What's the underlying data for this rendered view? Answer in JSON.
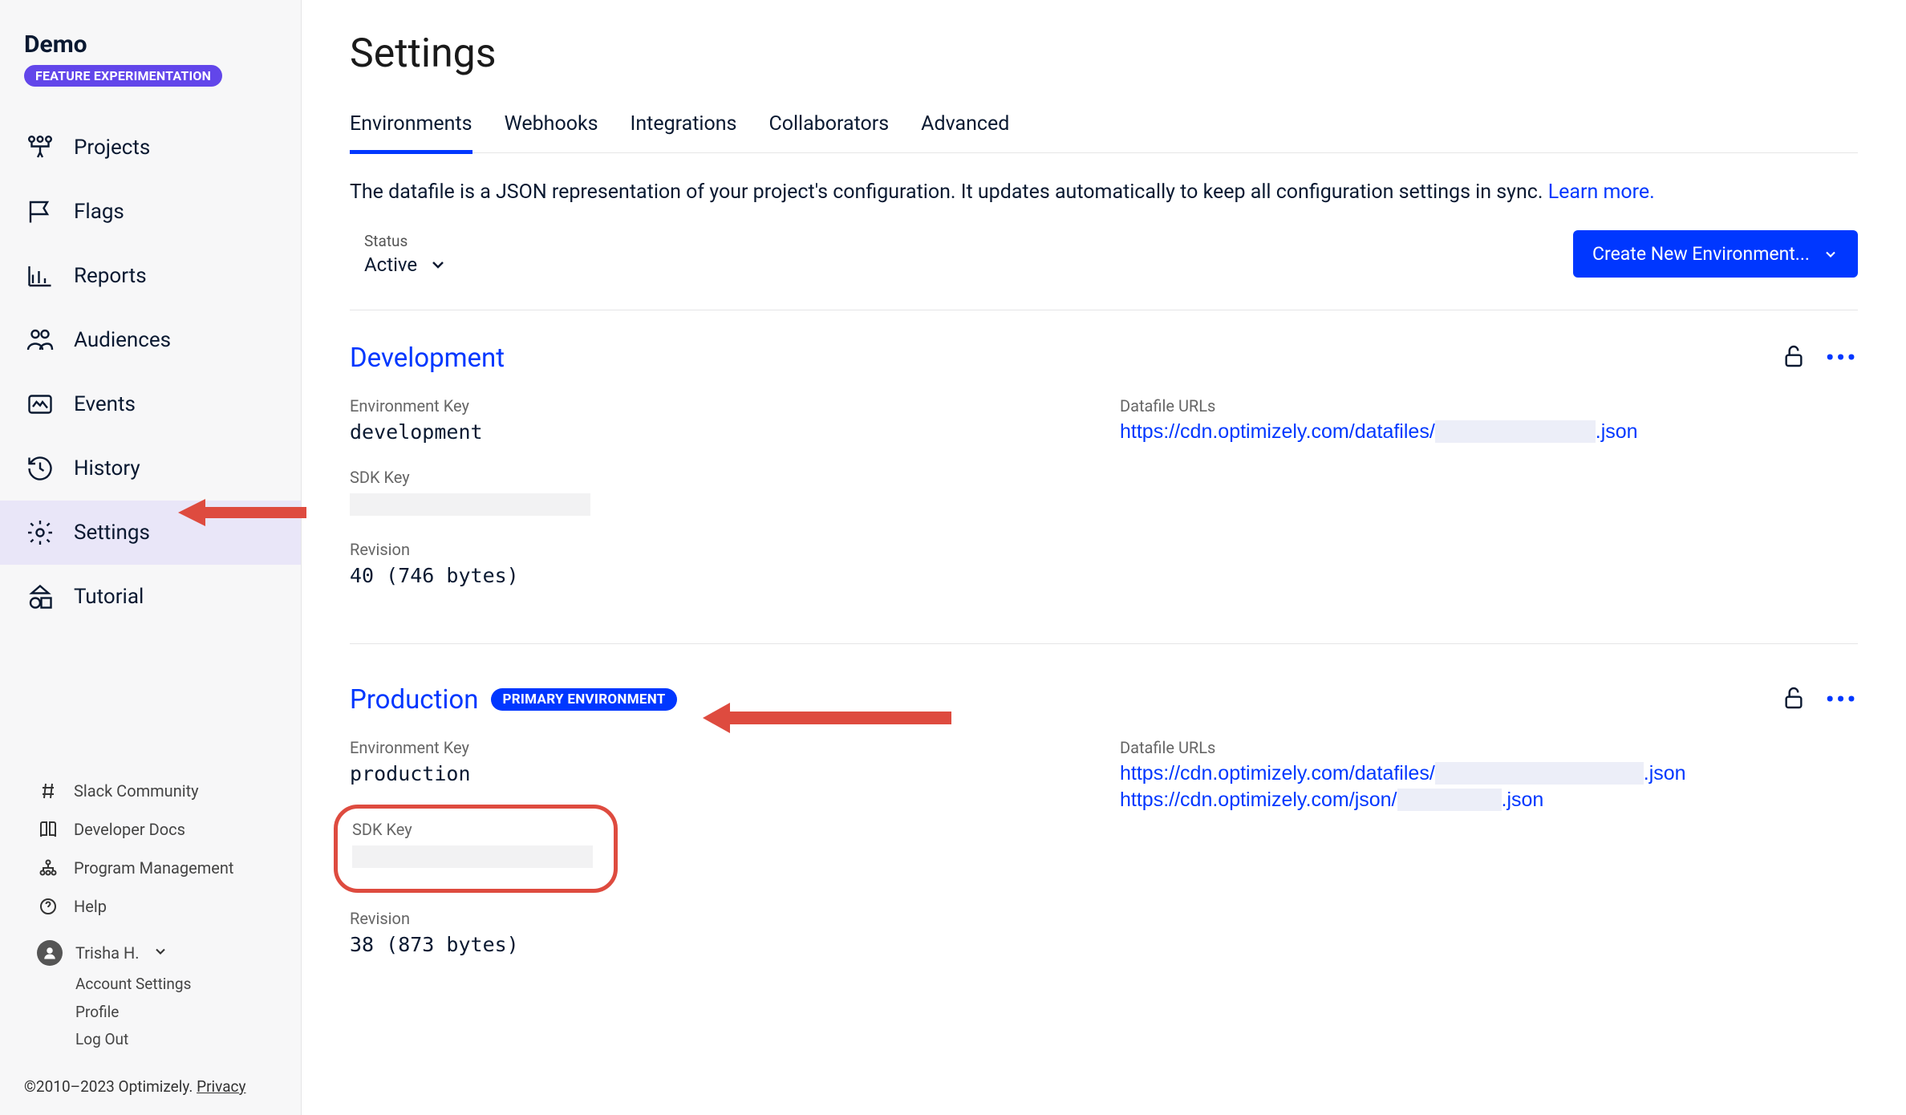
{
  "sidebar": {
    "title": "Demo",
    "badge": "FEATURE EXPERIMENTATION",
    "nav": [
      {
        "label": "Projects"
      },
      {
        "label": "Flags"
      },
      {
        "label": "Reports"
      },
      {
        "label": "Audiences"
      },
      {
        "label": "Events"
      },
      {
        "label": "History"
      },
      {
        "label": "Settings"
      },
      {
        "label": "Tutorial"
      }
    ],
    "bottom_links": [
      {
        "label": "Slack Community"
      },
      {
        "label": "Developer Docs"
      },
      {
        "label": "Program Management"
      },
      {
        "label": "Help"
      }
    ],
    "user": {
      "name": "Trisha H.",
      "sublinks": [
        "Account Settings",
        "Profile",
        "Log Out"
      ]
    }
  },
  "footer": {
    "copyright": "©2010–2023 Optimizely.",
    "privacy": "Privacy"
  },
  "page": {
    "title": "Settings",
    "tabs": [
      "Environments",
      "Webhooks",
      "Integrations",
      "Collaborators",
      "Advanced"
    ],
    "description": "The datafile is a JSON representation of your project's configuration. It updates automatically to keep all configuration settings in sync. ",
    "learn_more": "Learn more.",
    "filter": {
      "label": "Status",
      "value": "Active"
    },
    "create_button": "Create New Environment..."
  },
  "labels": {
    "environment_key": "Environment Key",
    "datafile_urls": "Datafile URLs",
    "sdk_key": "SDK Key",
    "revision": "Revision"
  },
  "environments": [
    {
      "name": "Development",
      "primary": false,
      "environment_key": "development",
      "datafile_urls": [
        {
          "prefix": "https://cdn.optimizely.com/datafiles/",
          "suffix": ".json"
        }
      ],
      "revision": "40 (746 bytes)"
    },
    {
      "name": "Production",
      "primary": true,
      "primary_label": "PRIMARY ENVIRONMENT",
      "environment_key": "production",
      "datafile_urls": [
        {
          "prefix": "https://cdn.optimizely.com/datafiles/",
          "suffix": ".json"
        },
        {
          "prefix": "https://cdn.optimizely.com/json/",
          "suffix": ".json"
        }
      ],
      "revision": "38 (873 bytes)"
    }
  ]
}
